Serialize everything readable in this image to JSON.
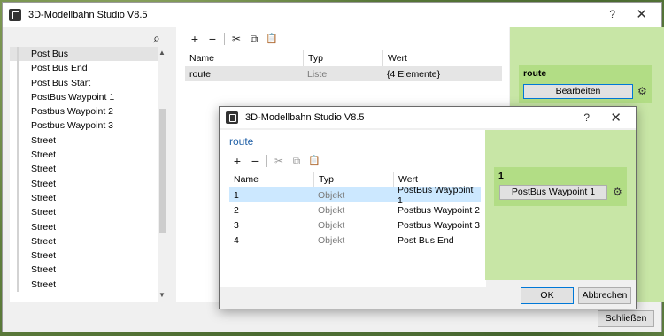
{
  "main_window": {
    "title": "3D-Modellbahn Studio V8.5",
    "help_glyph": "?",
    "close_glyph": "✕",
    "list_items": [
      "Post Bus",
      "Post Bus End",
      "Post Bus Start",
      "PostBus Waypoint 1",
      "Postbus Waypoint 2",
      "Postbus Waypoint 3",
      "Street",
      "Street",
      "Street",
      "Street",
      "Street",
      "Street",
      "Street",
      "Street",
      "Street",
      "Street",
      "Street"
    ],
    "table": {
      "headers": [
        "Name",
        "Typ",
        "Wert"
      ],
      "rows": [
        {
          "name": "route",
          "type": "Liste",
          "value": "{4 Elemente}"
        }
      ]
    },
    "right_panel": {
      "label": "route",
      "edit_button": "Bearbeiten"
    },
    "close_button": "Schließen"
  },
  "dialog": {
    "title": "3D-Modellbahn Studio V8.5",
    "help_glyph": "?",
    "close_glyph": "✕",
    "heading": "route",
    "table": {
      "headers": [
        "Name",
        "Typ",
        "Wert"
      ],
      "rows": [
        {
          "name": "1",
          "type": "Objekt",
          "value": "PostBus Waypoint 1"
        },
        {
          "name": "2",
          "type": "Objekt",
          "value": "Postbus Waypoint 2"
        },
        {
          "name": "3",
          "type": "Objekt",
          "value": "Postbus Waypoint 3"
        },
        {
          "name": "4",
          "type": "Objekt",
          "value": "Post Bus End"
        }
      ]
    },
    "right_panel": {
      "label": "1",
      "value_button": "PostBus Waypoint 1"
    },
    "ok_button": "OK",
    "cancel_button": "Abbrechen"
  },
  "toolbar": {
    "add": "+",
    "remove": "−",
    "cut_icon": "✂",
    "copy_icon": "⧉",
    "paste_icon": "📋"
  },
  "icons": {
    "search": "⌕",
    "gear": "⚙",
    "up": "▲",
    "down": "▼"
  },
  "colors": {
    "green_panel": "#c8e6a6",
    "green_box": "#b2dd85",
    "selection_blue": "#cce8ff",
    "accent_blue": "#0078d7"
  }
}
